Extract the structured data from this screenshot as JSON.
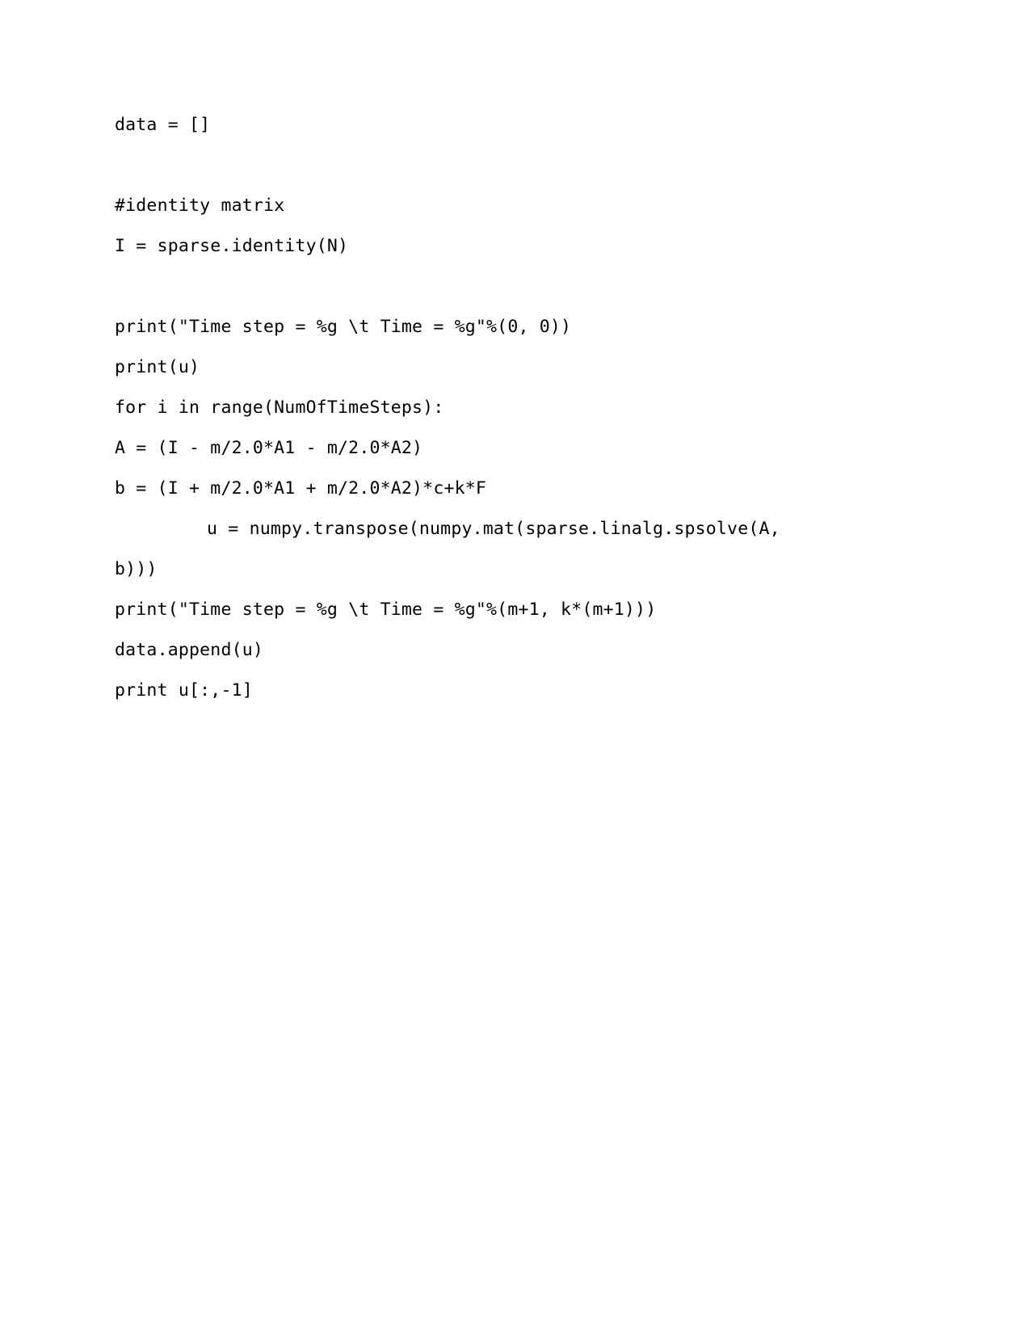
{
  "document": {
    "type": "code-listing",
    "language": "python",
    "page_background": "#ffffff",
    "text_color": "#000000",
    "lines": [
      {
        "id": "line-data-init",
        "indent": 0,
        "text": "data = []"
      },
      {
        "id": "blank-1",
        "indent": 0,
        "text": ""
      },
      {
        "id": "line-comment-identity",
        "indent": 0,
        "text": "#identity matrix"
      },
      {
        "id": "line-identity",
        "indent": 0,
        "text": "I = sparse.identity(N)"
      },
      {
        "id": "blank-2",
        "indent": 0,
        "text": ""
      },
      {
        "id": "line-print-header",
        "indent": 0,
        "text": "print(\"Time step = %g \\t Time = %g\"%(0, 0))"
      },
      {
        "id": "line-print-u",
        "indent": 0,
        "text": "print(u)"
      },
      {
        "id": "line-for-loop",
        "indent": 0,
        "text": "for i in range(NumOfTimeSteps):"
      },
      {
        "id": "line-assign-A",
        "indent": 1,
        "text": "A = (I - m/2.0*A1 - m/2.0*A2)"
      },
      {
        "id": "line-assign-b",
        "indent": 1,
        "text": "b = (I + m/2.0*A1 + m/2.0*A2)*c+k*F"
      },
      {
        "id": "line-assign-u",
        "indent": 1,
        "text": "u = numpy.transpose(numpy.mat(sparse.linalg.spsolve(A, b)))",
        "wraps": true,
        "head": "u = numpy.transpose(numpy.mat(sparse.linalg.spsolve(A,",
        "tail": "b)))"
      },
      {
        "id": "line-print-step",
        "indent": 1,
        "text": "print(\"Time step = %g \\t Time = %g\"%(m+1, k*(m+1)))"
      },
      {
        "id": "line-data-append",
        "indent": 1,
        "text": "data.append(u)"
      },
      {
        "id": "line-print-slice",
        "indent": 0,
        "text": "print u[:,-1]"
      }
    ]
  }
}
